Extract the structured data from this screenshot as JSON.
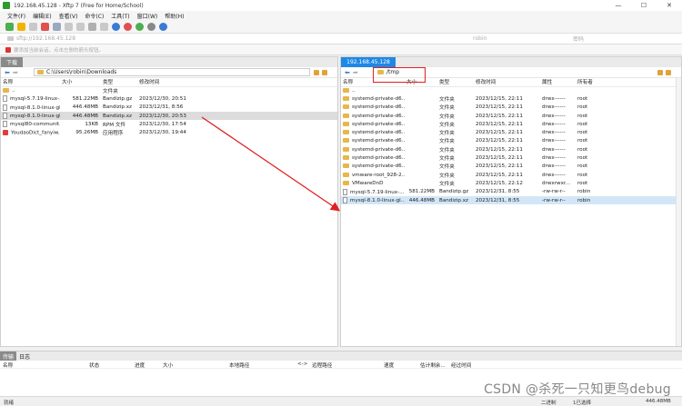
{
  "window": {
    "title": "192.168.45.128 - Xftp 7 (Free for Home/School)"
  },
  "menu": [
    "文件(F)",
    "编辑(E)",
    "查看(V)",
    "命令(C)",
    "工具(T)",
    "窗口(W)",
    "帮助(H)"
  ],
  "address": {
    "host": "sftp://192.168.45.128",
    "user": "robin",
    "password_placeholder": "密码"
  },
  "hint": "要添加当前会话，点击左侧的箭头按钮。",
  "left_pane": {
    "tab": "下载",
    "path": "C:\\Users\\robin\\Downloads",
    "columns": [
      "名称",
      "大小",
      "类型",
      "修改时间"
    ],
    "rows": [
      {
        "icon": "folder",
        "name": "..",
        "size": "",
        "type": "文件夹",
        "modified": ""
      },
      {
        "icon": "file",
        "name": "mysql-5.7.19-linux-...",
        "size": "581.22MB",
        "type": "Bandizip.gz",
        "modified": "2023/12/30, 20:51"
      },
      {
        "icon": "file",
        "name": "mysql-8.1.0-linux-gl...",
        "size": "446.48MB",
        "type": "Bandizip.xz",
        "modified": "2023/12/31, 8:56"
      },
      {
        "icon": "file",
        "name": "mysql-8.1.0-linux-gl...",
        "size": "446.48MB",
        "type": "Bandizip.xz",
        "modified": "2023/12/30, 20:53",
        "selected": true
      },
      {
        "icon": "file",
        "name": "mysql80-communit...",
        "size": "13KB",
        "type": "RPM 文件",
        "modified": "2023/12/30, 17:54"
      },
      {
        "icon": "app",
        "name": "YoudaoDict_fanyiw...",
        "size": "95.26MB",
        "type": "应用程序",
        "modified": "2023/12/30, 19:44"
      }
    ]
  },
  "right_pane": {
    "tab": "192.168.45.128",
    "path": "/tmp",
    "columns": [
      "名称",
      "大小",
      "类型",
      "修改时间",
      "属性",
      "所有者"
    ],
    "rows": [
      {
        "icon": "folder",
        "name": "..",
        "size": "",
        "type": "",
        "modified": "",
        "attr": "",
        "owner": ""
      },
      {
        "icon": "folder",
        "name": "systemd-private-d6...",
        "size": "",
        "type": "文件夹",
        "modified": "2023/12/15, 22:11",
        "attr": "drwx------",
        "owner": "root"
      },
      {
        "icon": "folder",
        "name": "systemd-private-d6...",
        "size": "",
        "type": "文件夹",
        "modified": "2023/12/15, 22:11",
        "attr": "drwx------",
        "owner": "root"
      },
      {
        "icon": "folder",
        "name": "systemd-private-d6...",
        "size": "",
        "type": "文件夹",
        "modified": "2023/12/15, 22:11",
        "attr": "drwx------",
        "owner": "root"
      },
      {
        "icon": "folder",
        "name": "systemd-private-d6...",
        "size": "",
        "type": "文件夹",
        "modified": "2023/12/15, 22:11",
        "attr": "drwx------",
        "owner": "root"
      },
      {
        "icon": "folder",
        "name": "systemd-private-d6...",
        "size": "",
        "type": "文件夹",
        "modified": "2023/12/15, 22:11",
        "attr": "drwx------",
        "owner": "root"
      },
      {
        "icon": "folder",
        "name": "systemd-private-d6...",
        "size": "",
        "type": "文件夹",
        "modified": "2023/12/15, 22:11",
        "attr": "drwx------",
        "owner": "root"
      },
      {
        "icon": "folder",
        "name": "systemd-private-d6...",
        "size": "",
        "type": "文件夹",
        "modified": "2023/12/15, 22:11",
        "attr": "drwx------",
        "owner": "root"
      },
      {
        "icon": "folder",
        "name": "systemd-private-d6...",
        "size": "",
        "type": "文件夹",
        "modified": "2023/12/15, 22:11",
        "attr": "drwx------",
        "owner": "root"
      },
      {
        "icon": "folder",
        "name": "systemd-private-d6...",
        "size": "",
        "type": "文件夹",
        "modified": "2023/12/15, 22:11",
        "attr": "drwx------",
        "owner": "root"
      },
      {
        "icon": "folder",
        "name": "vmware-root_928-2...",
        "size": "",
        "type": "文件夹",
        "modified": "2023/12/15, 22:11",
        "attr": "drwx------",
        "owner": "root"
      },
      {
        "icon": "folder",
        "name": "VMwareDnD",
        "size": "",
        "type": "文件夹",
        "modified": "2023/12/15, 22:12",
        "attr": "drwxrwxr...",
        "owner": "root"
      },
      {
        "icon": "file",
        "name": "mysql-5.7.19-linux-...",
        "size": "581.22MB",
        "type": "Bandizip.gz",
        "modified": "2023/12/31, 8:55",
        "attr": "-rw-rw-r--",
        "owner": "robin"
      },
      {
        "icon": "file",
        "name": "mysql-8.1.0-linux-gl...",
        "size": "446.48MB",
        "type": "Bandizip.xz",
        "modified": "2023/12/31, 8:55",
        "attr": "-rw-rw-r--",
        "owner": "robin",
        "selected": true
      }
    ]
  },
  "transfer": {
    "tabs": [
      "传输",
      "日志"
    ],
    "columns": [
      "名称",
      "状态",
      "进度",
      "大小",
      "本地路径",
      "<->",
      "远程路径",
      "速度",
      "估计剩余...",
      "经过时间"
    ]
  },
  "status": {
    "left": "就绪",
    "mid1": "二进制",
    "mid2": "1已选择",
    "right": "446.48MB"
  },
  "watermark": "CSDN @杀死一只知更鸟debug"
}
